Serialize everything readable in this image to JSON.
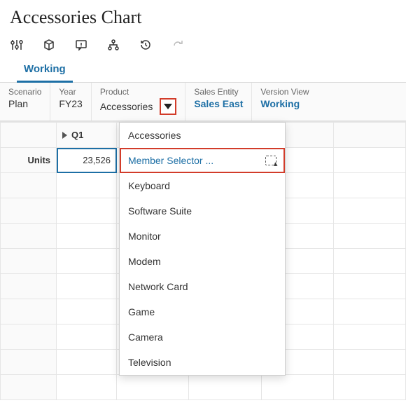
{
  "title": "Accessories Chart",
  "tab": "Working",
  "pov": {
    "scenario": {
      "label": "Scenario",
      "value": "Plan"
    },
    "year": {
      "label": "Year",
      "value": "FY23"
    },
    "product": {
      "label": "Product",
      "value": "Accessories"
    },
    "entity": {
      "label": "Sales Entity",
      "value": "Sales East"
    },
    "version": {
      "label": "Version View",
      "value": "Working"
    }
  },
  "grid": {
    "col_header": "Q1",
    "row_header": "Units",
    "cell_value": "23,526"
  },
  "dropdown": {
    "items": [
      "Accessories",
      "Member Selector ...",
      "Keyboard",
      "Software Suite",
      "Monitor",
      "Modem",
      "Network Card",
      "Game",
      "Camera",
      "Television"
    ],
    "highlight_index": 1
  }
}
